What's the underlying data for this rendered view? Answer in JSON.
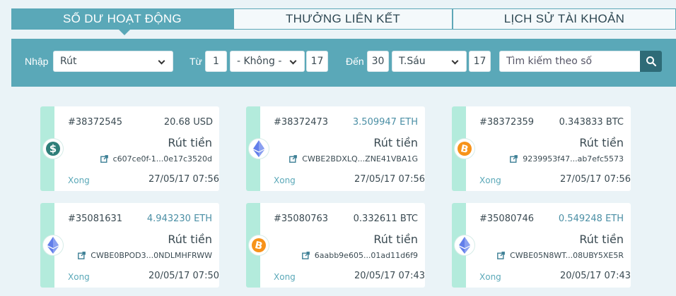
{
  "tabs": [
    {
      "label": "SỐ DƯ HOẠT ĐỘNG",
      "active": true
    },
    {
      "label": "THƯỞNG LIÊN KẾT",
      "active": false
    },
    {
      "label": "LỊCH SỬ TÀI KHOẢN",
      "active": false
    }
  ],
  "filters": {
    "type_label": "Nhập",
    "type_value": "Rút",
    "from_label": "Từ",
    "from_day": "1",
    "from_month": "- Không -",
    "from_year": "17",
    "to_label": "Đến",
    "to_day": "30",
    "to_month": "T.Sáu",
    "to_year": "17",
    "search_placeholder": "Tìm kiếm theo số"
  },
  "transactions": [
    {
      "id": "#38372545",
      "amount": "20.68 USD",
      "currency": "usd",
      "type": "Rút tiền",
      "hash": "c607ce0f-1...0e17c3520d",
      "status": "Xong",
      "date": "27/05/17 07:56"
    },
    {
      "id": "#38372473",
      "amount": "3.509947 ETH",
      "currency": "eth",
      "type": "Rút tiền",
      "hash": "CWBE2BDXLQ...ZNE41VBA1G",
      "status": "Xong",
      "date": "27/05/17 07:56"
    },
    {
      "id": "#38372359",
      "amount": "0.343833 BTC",
      "currency": "btc",
      "type": "Rút tiền",
      "hash": "9239953f47...ab7efc5573",
      "status": "Xong",
      "date": "27/05/17 07:56"
    },
    {
      "id": "#35081631",
      "amount": "4.943230 ETH",
      "currency": "eth",
      "type": "Rút tiền",
      "hash": "CWBE0BPOD3...0NDLMHFRWW",
      "status": "Xong",
      "date": "20/05/17 07:50"
    },
    {
      "id": "#35080763",
      "amount": "0.332611 BTC",
      "currency": "btc",
      "type": "Rút tiền",
      "hash": "6aabb9e605...01ad11d6f9",
      "status": "Xong",
      "date": "20/05/17 07:43"
    },
    {
      "id": "#35080746",
      "amount": "0.549248 ETH",
      "currency": "eth",
      "type": "Rút tiền",
      "hash": "CWBE05N8WT...08UBY5XE5R",
      "status": "Xong",
      "date": "20/05/17 07:43"
    }
  ],
  "icons": {
    "usd": "dollar-coin-icon",
    "eth": "ethereum-coin-icon",
    "btc": "bitcoin-coin-icon",
    "link": "external-link-icon",
    "search": "search-icon"
  },
  "colors": {
    "accent": "#5aa8b8",
    "stripe": "#b3ebdc",
    "btc": "#f7931a",
    "eth": "#627eea",
    "usd": "#2f7e79"
  }
}
